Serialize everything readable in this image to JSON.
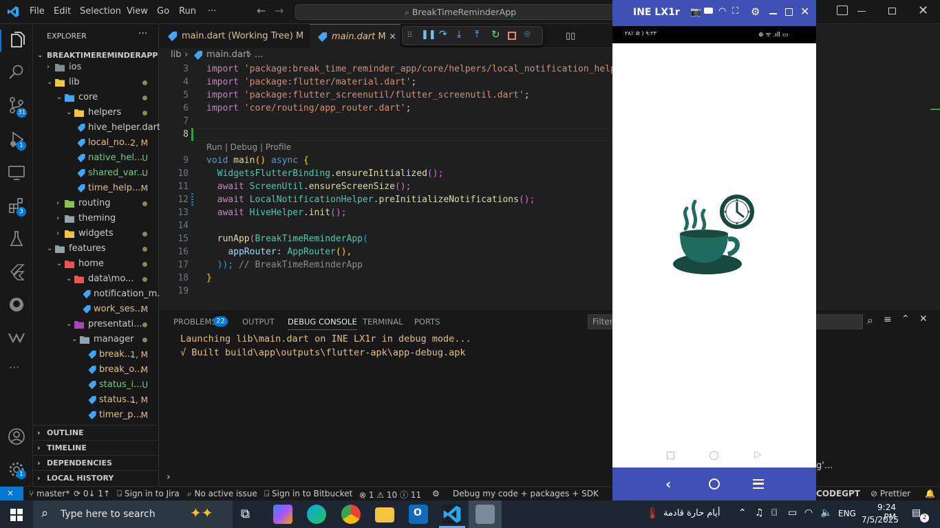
{
  "titlebar": {
    "menu": [
      "File",
      "Edit",
      "Selection",
      "View",
      "Go",
      "Run",
      "···"
    ],
    "search": "BreakTimeReminderApp"
  },
  "activity": {
    "source_control_badge": "31",
    "debug_badge": "1",
    "extensions_badge": "3",
    "settings_badge": "1"
  },
  "explorer": {
    "header": "EXPLORER",
    "more": "···",
    "root": "BREAKTIMEREMINDERAPP",
    "tree": [
      {
        "label": "ios",
        "status": ""
      },
      {
        "label": "lib",
        "status": ""
      },
      {
        "label": "core",
        "status": ""
      },
      {
        "label": "helpers",
        "status": ""
      },
      {
        "label": "hive_helper.dart",
        "status": ""
      },
      {
        "label": "local_no...",
        "status": "2, M"
      },
      {
        "label": "native_hel...",
        "status": "U"
      },
      {
        "label": "shared_var...",
        "status": "U"
      },
      {
        "label": "time_help...",
        "status": "M"
      },
      {
        "label": "routing",
        "status": ""
      },
      {
        "label": "theming",
        "status": ""
      },
      {
        "label": "widgets",
        "status": ""
      },
      {
        "label": "features",
        "status": ""
      },
      {
        "label": "home",
        "status": ""
      },
      {
        "label": "data\\mo...",
        "status": ""
      },
      {
        "label": "notification_m...",
        "status": ""
      },
      {
        "label": "work_ses...",
        "status": "M"
      },
      {
        "label": "presentati...",
        "status": ""
      },
      {
        "label": "manager",
        "status": ""
      },
      {
        "label": "break...",
        "status": "1, M"
      },
      {
        "label": "break_o...",
        "status": "M"
      },
      {
        "label": "status_i...",
        "status": "U"
      },
      {
        "label": "status...",
        "status": "1, M"
      },
      {
        "label": "timer_p...",
        "status": "M"
      }
    ],
    "sections": [
      "OUTLINE",
      "TIMELINE",
      "DEPENDENCIES",
      "LOCAL HISTORY"
    ]
  },
  "tabs": [
    {
      "label": "main.dart (Working Tree)",
      "status": "M"
    },
    {
      "label": "main.dart",
      "status": "M",
      "close": "×"
    }
  ],
  "breadcrumb": {
    "folder": "lib",
    "file": "main.dart",
    "more": "..."
  },
  "editor": {
    "line_numbers": [
      "3",
      "4",
      "5",
      "6",
      "7",
      "8",
      "9",
      "10",
      "11",
      "12",
      "13",
      "14",
      "15",
      "16",
      "17",
      "18",
      "19"
    ],
    "codelens": "Run | Debug | Profile",
    "lines": {
      "l3a": "import ",
      "l3b": "'package:break_time_reminder_app/core/helpers/local_notification_helpe",
      "l4a": "import ",
      "l4b": "'package:flutter/material.dart'",
      "l4c": ";",
      "l5a": "import ",
      "l5b": "'package:flutter_screenutil/flutter_screenutil.dart'",
      "l5c": ";",
      "l6a": "import ",
      "l6b": "'core/routing/app_router.dart'",
      "l6c": ";",
      "l9a": "void ",
      "l9b": "main",
      "l9c": "() ",
      "l9d": "async",
      " l9e": " {",
      "l10a": "WidgetsFlutterBinding",
      "l10b": ".",
      "l10c": "ensureInitialized",
      "l10d": "();",
      "l11a": "await ",
      "l11b": "ScreenUtil",
      "l11c": ".",
      "l11d": "ensureScreenSize",
      "l11e": "();",
      "l12a": "await ",
      "l12b": "LocalNotificationHelper",
      "l12c": ".",
      "l12d": "preInitializeNotifications",
      "l12e": "();",
      "l13a": "await ",
      "l13b": "HiveHelper",
      "l13c": ".",
      "l13d": "init",
      "l13e": "();",
      "l15a": "runApp",
      "l15b": "(",
      "l15c": "BreakTimeReminderApp",
      "l15d": "(",
      "l16a": "appRouter",
      "l16b": ": ",
      "l16c": "AppRouter",
      "l16d": "(),",
      "l17a": "));",
      "l17b": " // BreakTimeReminderApp",
      "l18a": "}"
    }
  },
  "panel": {
    "tabs": [
      "PROBLEMS",
      "OUTPUT",
      "DEBUG CONSOLE",
      "TERMINAL",
      "PORTS"
    ],
    "problems_count": "22",
    "filter_placeholder": "Filter",
    "console": [
      "Launching lib\\main.dart on INE LX1r in debug mode...",
      "√ Built build\\app\\outputs\\flutter-apk\\app-debug.apk"
    ],
    "notification_fragment": "g'..."
  },
  "statusbar": {
    "branch": "master*",
    "sync": "0↓ 1↑",
    "jira": "Sign in to Jira",
    "issue": "No active issue",
    "bitbucket": "Sign in to Bitbucket",
    "errors": "1",
    "warnings": "10",
    "infos": "11",
    "debug_config": "Debug my code + packages + SDK",
    "codegpt": "CODEGPT",
    "prettier": "Prettier"
  },
  "emulator": {
    "title": "INE LX1r",
    "status_left": "٩:٢٣ ⟨ ⊘ ٪٢٨",
    "status_right": "⊕ ᯤ .ıll ▭"
  },
  "taskbar": {
    "search_placeholder": "Type here to search",
    "weather": "أيام حارة قادمة",
    "lang": "ENG",
    "time": "9:24 PM",
    "date": "7/5/2025",
    "notif_count": "2"
  },
  "colors": {
    "accent": "#0078d4",
    "emulator_bar": "#3f51b5",
    "teal_icon": "#1f6b5f",
    "modified": "#e2c08d",
    "untracked": "#73c991"
  }
}
